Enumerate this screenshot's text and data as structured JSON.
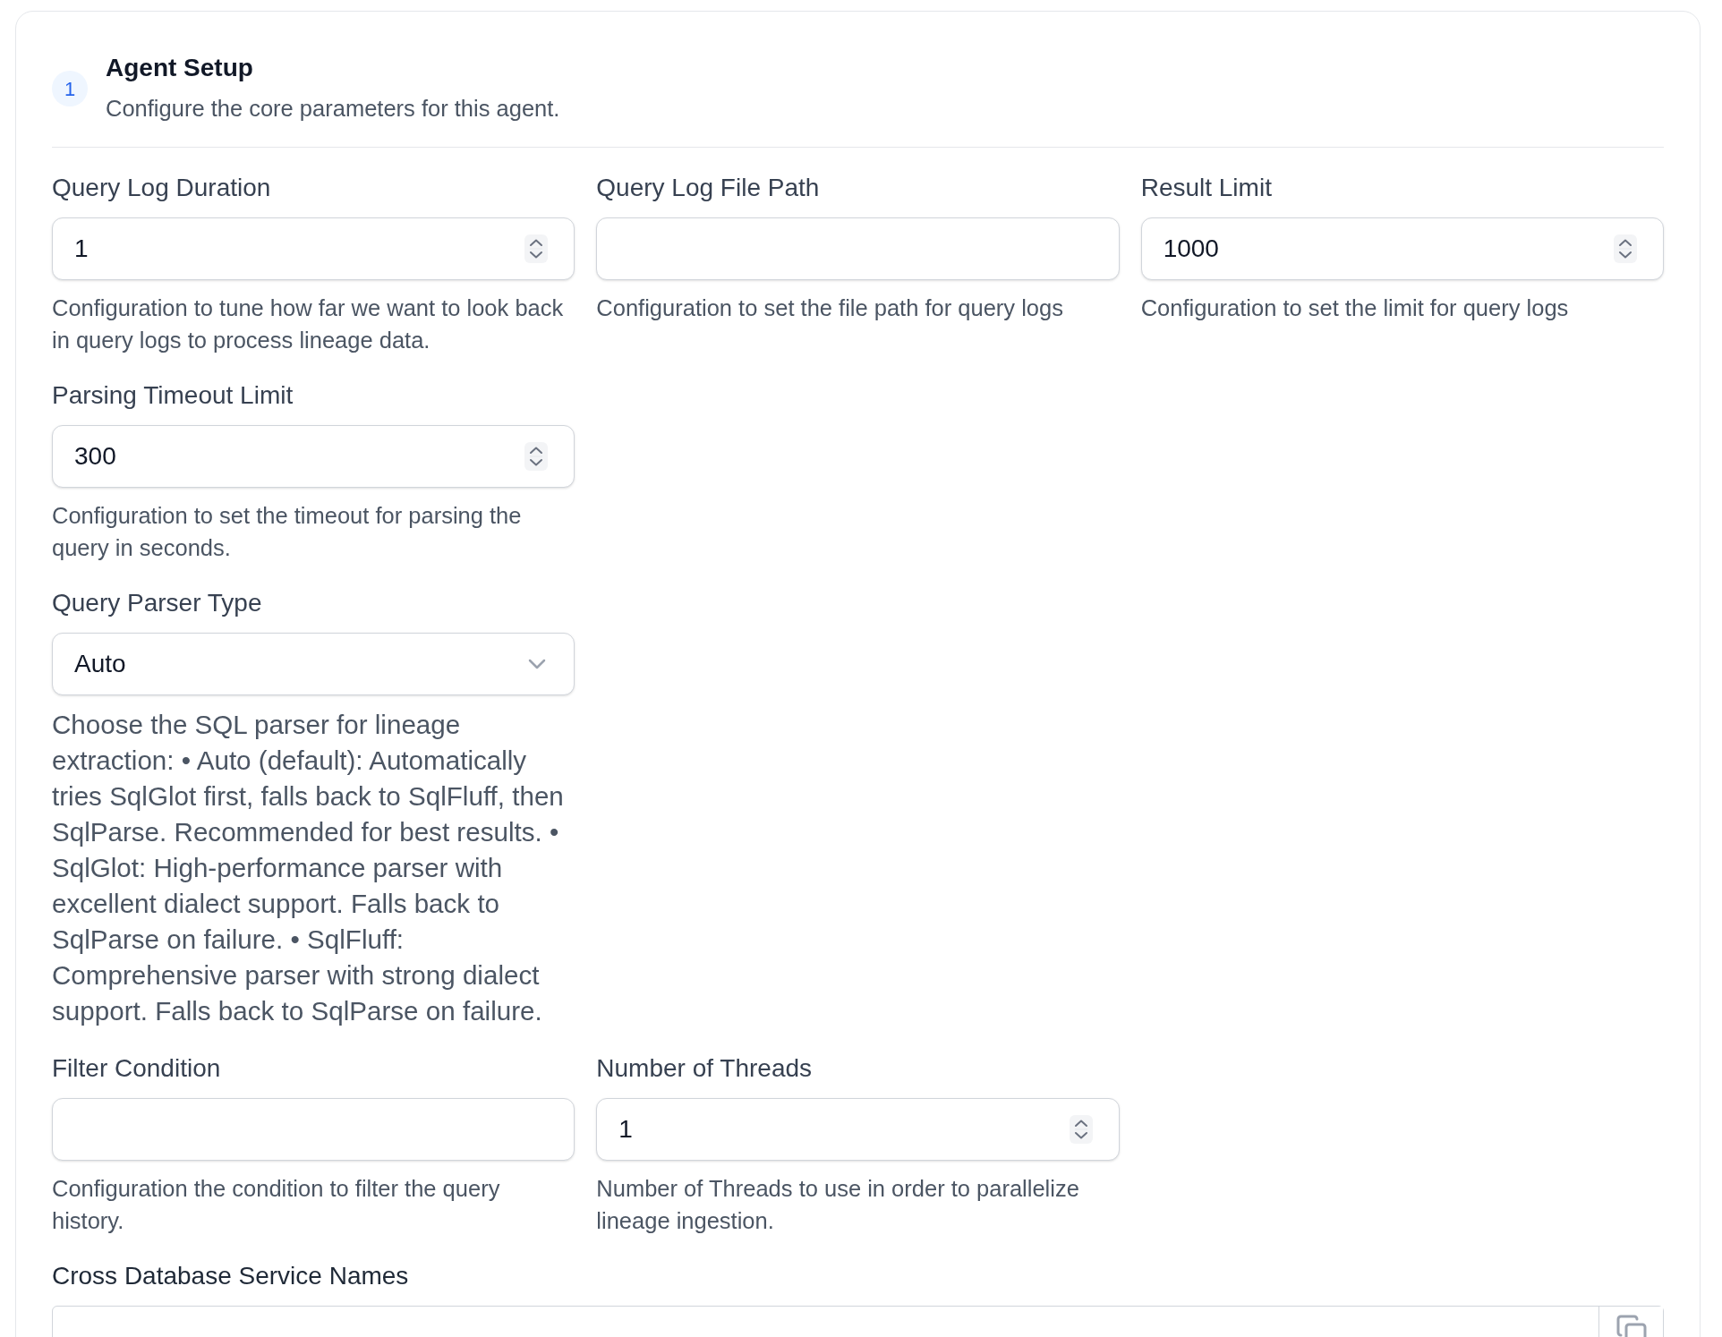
{
  "section": {
    "step": "1",
    "title": "Agent Setup",
    "subtitle": "Configure the core parameters for this agent."
  },
  "rows": [
    {
      "fields": [
        {
          "kind": "number",
          "label": "Query Log Duration",
          "value": "1",
          "description": {
            "kind": "plain",
            "text": "Configuration to tune how far we want to look back in query logs to process lineage data."
          }
        },
        {
          "kind": "text",
          "label": "Query Log File Path",
          "description": {
            "kind": "plain",
            "text": "Configuration to set the file path for query logs"
          }
        },
        {
          "kind": "number",
          "label": "Result Limit",
          "value": "1000",
          "description": {
            "kind": "plain",
            "text": "Configuration to set the limit for query logs"
          }
        }
      ]
    },
    {
      "fields": [
        {
          "kind": "number",
          "label": "Parsing Timeout Limit",
          "value": "300",
          "description": {
            "kind": "plain",
            "text": "Configuration to set the timeout for parsing the query in seconds."
          }
        }
      ]
    },
    {
      "fields": [
        {
          "kind": "select",
          "label": "Query Parser Type",
          "value": "Auto",
          "description": {
            "kind": "markdown",
            "text": "Choose the SQL parser for lineage extraction: • Auto (default): Automatically tries SqlGlot first, falls back to SqlFluff, then SqlParse. Recommended for best results. • SqlGlot: High-performance parser with excellent dialect support. Falls back to SqlParse on failure. • SqlFluff: Comprehensive parser with strong dialect support. Falls back to SqlParse on failure."
          }
        }
      ]
    },
    {
      "fields": [
        {
          "kind": "text",
          "label": "Filter Condition",
          "description": {
            "kind": "plain",
            "text": "Configuration the condition to filter the query history."
          }
        },
        {
          "kind": "number",
          "label": "Number of Threads",
          "value": "1",
          "description": {
            "kind": "plain",
            "text": "Number of Threads to use in order to parallelize lineage ingestion."
          }
        }
      ]
    },
    {
      "fields": [
        {
          "kind": "list",
          "label": "Cross Database Service Names"
        }
      ]
    }
  ]
}
